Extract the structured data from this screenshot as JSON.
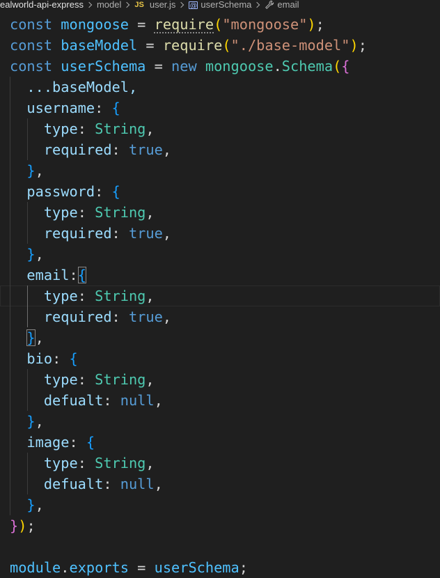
{
  "breadcrumb": {
    "folder1": "ealworld-api-express",
    "folder2": "model",
    "file_icon": "JS",
    "file": "user.js",
    "symbol_icon": "[@]",
    "symbol": "userSchema",
    "property": "email"
  },
  "code": {
    "l1": {
      "kw": "const",
      "name": "mongoose",
      "eq": " = ",
      "fn": "require",
      "open": "(",
      "str": "\"mongoose\"",
      "close": ");"
    },
    "l2": {
      "kw": "const",
      "name": "baseModel",
      "eq": " = ",
      "fn": "require",
      "open": "(",
      "str": "\"./base-model\"",
      "close": ");"
    },
    "l3": {
      "kw": "const",
      "name": "userSchema",
      "eq": " = ",
      "new": "new",
      "obj": "mongoose",
      "dot": ".",
      "cls": "Schema",
      "open_paren": "(",
      "open_brace": "{"
    },
    "l4": {
      "spread": "...baseModel,"
    },
    "l5": {
      "key": "username",
      "colon": ": ",
      "brace": "{"
    },
    "l6": {
      "key": "type",
      "colon": ": ",
      "val": "String",
      "comma": ","
    },
    "l7": {
      "key": "required",
      "colon": ": ",
      "val": "true",
      "comma": ","
    },
    "l8": {
      "brace": "}",
      "comma": ","
    },
    "l9": {
      "key": "password",
      "colon": ": ",
      "brace": "{"
    },
    "l10": {
      "key": "type",
      "colon": ": ",
      "val": "String",
      "comma": ","
    },
    "l11": {
      "key": "required",
      "colon": ": ",
      "val": "true",
      "comma": ","
    },
    "l12": {
      "brace": "}",
      "comma": ","
    },
    "l13": {
      "key": "email",
      "colon": ":",
      "brace": "{"
    },
    "l14": {
      "key": "type",
      "colon": ": ",
      "val": "String",
      "comma": ","
    },
    "l15": {
      "key": "required",
      "colon": ": ",
      "val": "true",
      "comma": ","
    },
    "l16": {
      "brace": "}",
      "comma": ","
    },
    "l17": {
      "key": "bio",
      "colon": ": ",
      "brace": "{"
    },
    "l18": {
      "key": "type",
      "colon": ": ",
      "val": "String",
      "comma": ","
    },
    "l19": {
      "key": "defualt",
      "colon": ": ",
      "val": "null",
      "comma": ","
    },
    "l20": {
      "brace": "}",
      "comma": ","
    },
    "l21": {
      "key": "image",
      "colon": ": ",
      "brace": "{"
    },
    "l22": {
      "key": "type",
      "colon": ": ",
      "val": "String",
      "comma": ","
    },
    "l23": {
      "key": "defualt",
      "colon": ": ",
      "val": "null",
      "comma": ","
    },
    "l24": {
      "brace": "}",
      "comma": ","
    },
    "l25": {
      "brace": "}",
      "paren": ")",
      "semi": ";"
    },
    "l26": {
      "text": ""
    },
    "l27": {
      "obj": "module",
      "dot": ".",
      "prop": "exports",
      "eq": " = ",
      "val": "userSchema",
      "semi": ";"
    }
  },
  "colors": {
    "background": "#1f1f1f",
    "keyword": "#569cd6",
    "string": "#ce9178",
    "function": "#dcdcaa",
    "property": "#9cdcfe",
    "class": "#4ec9b0",
    "bracket_gold": "#ffd700",
    "bracket_orchid": "#da70d6",
    "bracket_blue": "#179fff"
  }
}
